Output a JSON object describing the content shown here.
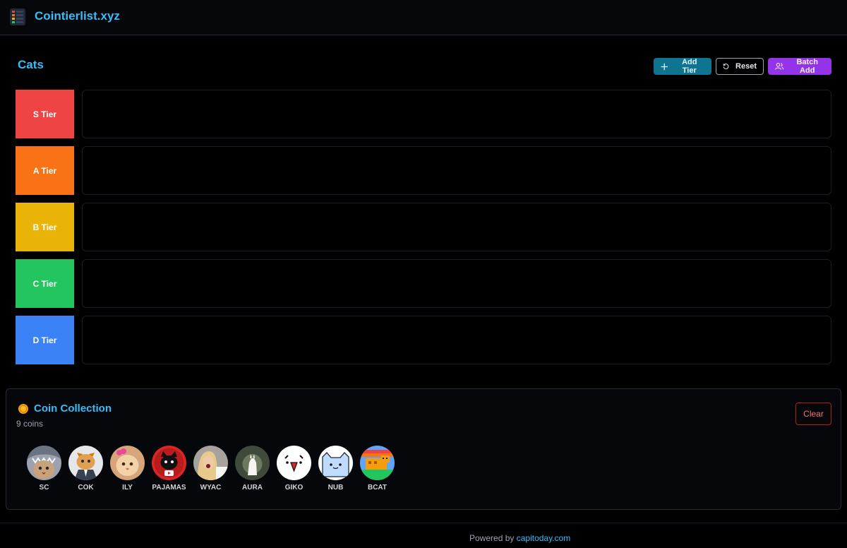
{
  "header": {
    "brand": "Cointierlist.xyz"
  },
  "list": {
    "title": "Cats"
  },
  "toolbar": {
    "add_tier_label": "Add Tier",
    "reset_label": "Reset",
    "batch_add_label": "Batch Add"
  },
  "tiers": [
    {
      "label": "S Tier",
      "color": "#ef4444"
    },
    {
      "label": "A Tier",
      "color": "#f97316"
    },
    {
      "label": "B Tier",
      "color": "#eab308"
    },
    {
      "label": "C Tier",
      "color": "#22c55e"
    },
    {
      "label": "D Tier",
      "color": "#3b82f6"
    }
  ],
  "collection": {
    "title": "Coin Collection",
    "count_text": "9 coins",
    "clear_label": "Clear",
    "coins": [
      {
        "symbol": "SC",
        "icon": "cat-in-shark-costume-icon"
      },
      {
        "symbol": "COK",
        "icon": "cat-in-suit-icon"
      },
      {
        "symbol": "ILY",
        "icon": "cat-with-bow-icon"
      },
      {
        "symbol": "PAJAMAS",
        "icon": "black-cartoon-cat-icon"
      },
      {
        "symbol": "WYAC",
        "icon": "woman-yelling-icon"
      },
      {
        "symbol": "AURA",
        "icon": "white-cat-glow-icon"
      },
      {
        "symbol": "GIKO",
        "icon": "giko-face-icon"
      },
      {
        "symbol": "NUB",
        "icon": "blue-cartoon-cat-icon"
      },
      {
        "symbol": "BCAT",
        "icon": "pixel-cat-icon"
      }
    ]
  },
  "footer": {
    "powered_by": "Powered by",
    "link_text": "capitoday.com"
  }
}
